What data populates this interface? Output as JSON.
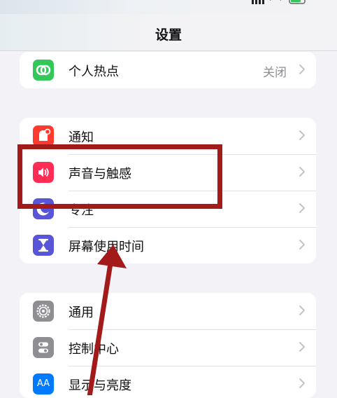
{
  "nav": {
    "title": "设置"
  },
  "groups": [
    {
      "items": [
        {
          "label": "个人热点",
          "value": "关闭",
          "icon": "hotspot-icon",
          "color": "#34c759"
        }
      ]
    },
    {
      "items": [
        {
          "label": "通知",
          "icon": "notification-icon",
          "color": "#ff3b30"
        },
        {
          "label": "声音与触感",
          "icon": "sound-icon",
          "color": "#ff2d55"
        },
        {
          "label": "专注",
          "icon": "focus-moon-icon",
          "color": "#5856d6"
        },
        {
          "label": "屏幕使用时间",
          "icon": "screen-time-hourglass-icon",
          "color": "#5856d6"
        }
      ]
    },
    {
      "items": [
        {
          "label": "通用",
          "icon": "general-gear-icon",
          "color": "#8e8e93"
        },
        {
          "label": "控制中心",
          "icon": "control-center-icon",
          "color": "#8e8e93"
        },
        {
          "label": "显示与亮度",
          "icon": "display-brightness-icon",
          "color": "#007aff",
          "glyph": "AA"
        }
      ]
    }
  ],
  "annotation": {
    "highlighted_item": "声音与触感",
    "color": "#a21a1a"
  }
}
